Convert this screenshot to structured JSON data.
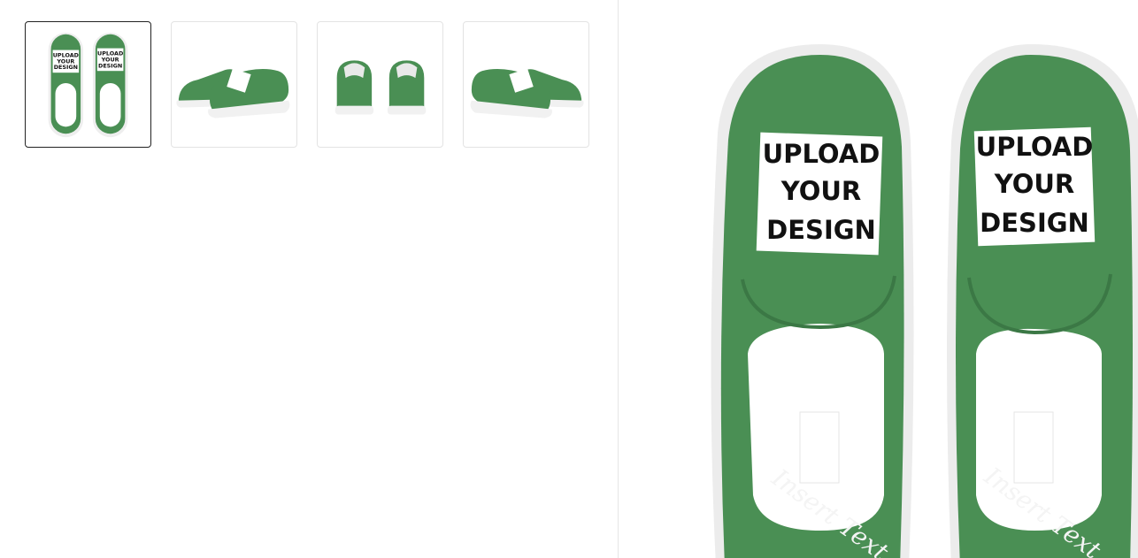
{
  "gallery": {
    "thumbnails": [
      {
        "view": "top",
        "selected": true
      },
      {
        "view": "side-left",
        "selected": false
      },
      {
        "view": "back",
        "selected": false
      },
      {
        "view": "side-right",
        "selected": false
      }
    ]
  },
  "product": {
    "print_area_text": [
      "UPLOAD",
      "YOUR",
      "DESIGN"
    ],
    "heel_text": "Insert Text",
    "colors": {
      "shoe_green": "#4a8f54",
      "sole": "#f2f2f2",
      "lining": "#ffffff"
    }
  }
}
